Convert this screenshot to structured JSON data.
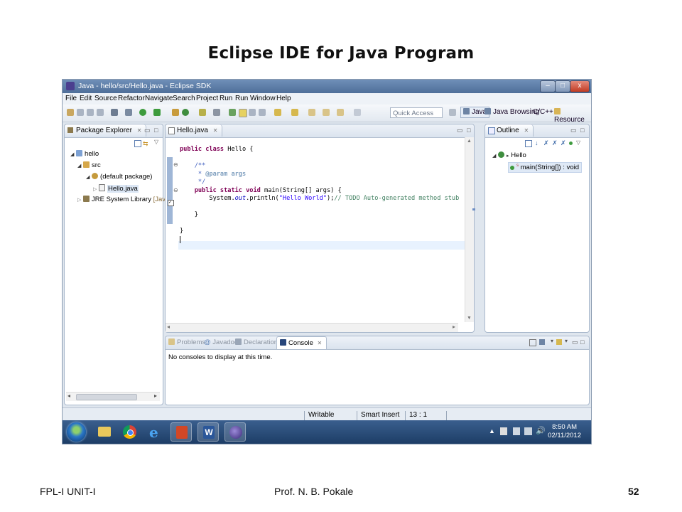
{
  "slide": {
    "title": "Eclipse IDE for Java Program",
    "footer_left": "FPL-I UNIT-I",
    "footer_center": "Prof. N. B. Pokale",
    "page_number": "52"
  },
  "window": {
    "title": "Java - hello/src/Hello.java - Eclipse SDK",
    "controls": {
      "minimize": "–",
      "maximize": "□",
      "close": "x"
    }
  },
  "menu": [
    "File",
    "Edit",
    "Source",
    "Refactor",
    "Navigate",
    "Search",
    "Project",
    "Run",
    "Run",
    "Window",
    "Help"
  ],
  "toolbar": {
    "quick_access_placeholder": "Quick Access",
    "perspectives": [
      "Java",
      "Java Browsing",
      "C/C++",
      "Resource"
    ]
  },
  "package_explorer": {
    "tab": "Package Explorer",
    "tree": [
      {
        "label": "hello",
        "level": 0,
        "icon": "project-icon"
      },
      {
        "label": "src",
        "level": 1,
        "icon": "source-folder-icon"
      },
      {
        "label": "(default package)",
        "level": 2,
        "icon": "package-icon"
      },
      {
        "label": "Hello.java",
        "level": 3,
        "icon": "java-file-icon"
      },
      {
        "label": "JRE System Library",
        "level": 1,
        "icon": "library-icon",
        "suffix": "[JavaSE"
      }
    ]
  },
  "editor": {
    "tab": "Hello.java",
    "code": {
      "l1_kw": "public class",
      "l1_rest": " Hello {",
      "l3": "/**",
      "l4a": " * ",
      "l4b": "@param args",
      "l5": " */",
      "l6_kw": "public static void",
      "l6_rest": " main(String[] args) {",
      "l7a": "    System.",
      "l7_out": "out",
      "l7b": ".println(",
      "l7_str": "\"Hello World\"",
      "l7c": ");",
      "l7_comment": "// TODO Auto-generated method stub",
      "l9": "}",
      "l11": "}"
    }
  },
  "outline": {
    "tab": "Outline",
    "class_name": "Hello",
    "method": "main(String[]) : void"
  },
  "console": {
    "tabs": [
      "Problems",
      "Javadoc",
      "Declaration",
      "Console"
    ],
    "message": "No consoles to display at this time."
  },
  "status": {
    "mode": "Writable",
    "insert": "Smart Insert",
    "position": "13 : 1"
  },
  "taskbar": {
    "time": "8:50 AM",
    "date": "02/11/2012"
  },
  "colors": {
    "title_bar": "#4f6f99",
    "keyword": "#7f0055",
    "javadoc": "#3f5fbf",
    "comment": "#3f7f5f",
    "string": "#2a00ff"
  }
}
